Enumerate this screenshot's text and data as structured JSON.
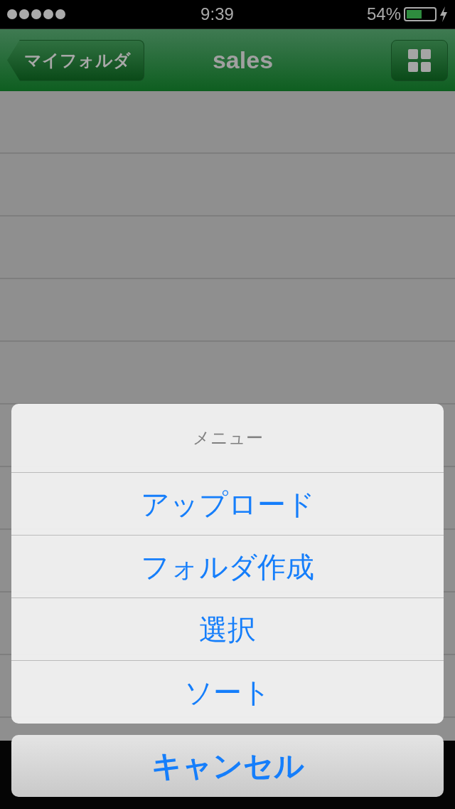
{
  "status_bar": {
    "time": "9:39",
    "battery_percent": "54%",
    "battery": {
      "level": 0.54
    },
    "charging": true
  },
  "nav_bar": {
    "back_button": "マイフォルダ",
    "title": "sales"
  },
  "action_sheet": {
    "title": "メニュー",
    "items": [
      "アップロード",
      "フォルダ作成",
      "選択",
      "ソート"
    ],
    "cancel": "キャンセル"
  }
}
